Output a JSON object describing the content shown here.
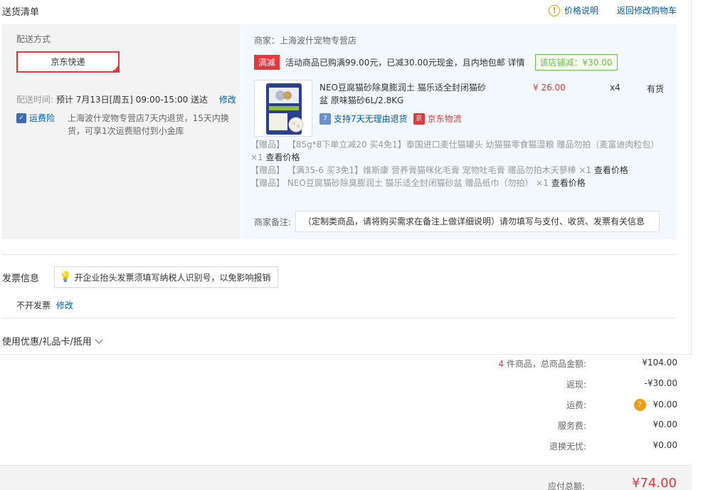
{
  "header": {
    "title": "送货清单",
    "price_note": "价格说明",
    "back_to_cart": "返回修改购物车"
  },
  "shipping": {
    "method_label": "配送方式",
    "method_value": "京东快递",
    "time_label": "配送时间:",
    "time_value": "预计 7月13日[周五] 09:00-15:00 送达",
    "time_edit": "修改",
    "insurance_label": "运费险",
    "insurance_text": "上海波什宠物专营店7天内退货，15天内换货，可享1次运费赔付到小金库"
  },
  "order": {
    "shop": "商家：上海波什宠物专营店",
    "promo_tag": "满减",
    "promo_text": "活动商品已购满99.00元，已减30.00元现金，且内地包邮 详情",
    "promo_save": "该店铺减：¥30.00",
    "product": {
      "name": "NEO豆腐猫砂除臭膨润土 猫乐适全封闭猫砂盆 原味猫砂6L/2.8KG",
      "price": "¥ 26.00",
      "qty": "x4",
      "stock": "有货",
      "service": "支持7天无理由退货",
      "logistics": "京东物流"
    },
    "gifts": [
      {
        "text": "【赠品】 【85g*8下单立减20 买4免1】泰国进口麦仕猫罐头 幼猫猫零食猫湿粮 赠品勿拍（麦富迪肉粒包） ×1",
        "link": "查看价格"
      },
      {
        "text": "【赠品】 【满35-6 买3免1】维斯康 营养膏猫咪化毛膏 宠物吐毛膏 赠品勿拍木天蓼棒 ×1",
        "link": "查看价格"
      },
      {
        "text": "【赠品】 NEO豆腐猫砂除臭膨润土 猫乐适全封闭猫砂盆 赠品纸巾（勿拍） ×1",
        "link": "查看价格"
      }
    ],
    "remark_label": "商家备注:",
    "remark_placeholder": "（定制类商品，请将购买需求在备注上做详细说明）请勿填写与支付、收货、发票有关信息"
  },
  "invoice": {
    "title": "发票信息",
    "tip": "开企业抬头发票须填写纳税人识别号，以免影响报销",
    "status": "不开发票",
    "edit": "修改"
  },
  "coupon": {
    "label": "使用优惠/礼品卡/抵用"
  },
  "summary": {
    "item_count": "4",
    "item_label": "件商品，总商品金额:",
    "item_total": "¥104.00",
    "rebate_label": "返现:",
    "rebate": "-¥30.00",
    "freight_label": "运费:",
    "freight": "¥0.00",
    "service_label": "服务费:",
    "service": "¥0.00",
    "return_label": "退换无忧:",
    "return": "¥0.00",
    "payable_label": "应付总额:",
    "payable": "¥74.00"
  }
}
